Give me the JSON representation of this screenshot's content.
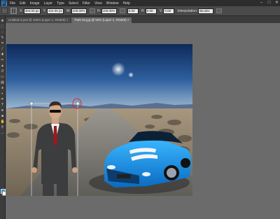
{
  "app": {
    "logo": "Ps"
  },
  "menu": [
    "File",
    "Edit",
    "Image",
    "Layer",
    "Type",
    "Select",
    "Filter",
    "View",
    "Window",
    "Help"
  ],
  "window_controls": [
    "–",
    "□",
    "✕"
  ],
  "options": {
    "x_label": "X:",
    "x_value": "304.00 px",
    "y_label": "Y:",
    "y_value": "424.00 px",
    "w_label": "W:",
    "w_value": "100.00%",
    "h_label": "H:",
    "h_value": "100.00%",
    "angle_value": "0.00",
    "hskew_label": "H:",
    "hskew_value": "0.00",
    "vskew_label": "V:",
    "vskew_value": "0.00",
    "interp_label": "Interpolation:",
    "interp_value": "Bicubic"
  },
  "tabs": [
    {
      "label": "Untitled-3.psd @ 100% (Layer 1, RGB/8) ×",
      "active": false
    },
    {
      "label": "Park 02.jpg @ 50% (Layer 1, RGB/8) ×",
      "active": true
    }
  ],
  "colors": {
    "foreground": "#1ba2ea",
    "background": "#ffffff",
    "annotation": "#e0202a"
  },
  "icons": [
    "move-icon",
    "marquee-icon",
    "lasso-icon",
    "quick-select-icon",
    "crop-icon",
    "eyedropper-icon",
    "healing-icon",
    "brush-icon",
    "clone-stamp-icon",
    "history-brush-icon",
    "eraser-icon",
    "gradient-icon",
    "blur-icon",
    "dodge-icon",
    "pen-icon",
    "type-icon",
    "path-select-icon",
    "shape-icon",
    "hand-icon",
    "zoom-icon"
  ]
}
